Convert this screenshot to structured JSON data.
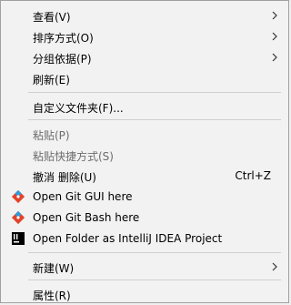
{
  "menu": {
    "view": "查看(V)",
    "sort": "排序方式(O)",
    "group": "分组依据(P)",
    "refresh": "刷新(E)",
    "customize": "自定义文件夹(F)...",
    "paste": "粘贴(P)",
    "paste_shortcut": "粘贴快捷方式(S)",
    "undo_delete": "撤消 删除(U)",
    "undo_shortcut": "Ctrl+Z",
    "git_gui": "Open Git GUI here",
    "git_bash": "Open Git Bash here",
    "intellij": "Open Folder as IntelliJ IDEA Project",
    "new": "新建(W)",
    "properties": "属性(R)"
  },
  "icons": {
    "git_gui": "git-gui-icon",
    "git_bash": "git-bash-icon",
    "intellij": "intellij-idea-icon",
    "submenu": "chevron-right-icon"
  }
}
